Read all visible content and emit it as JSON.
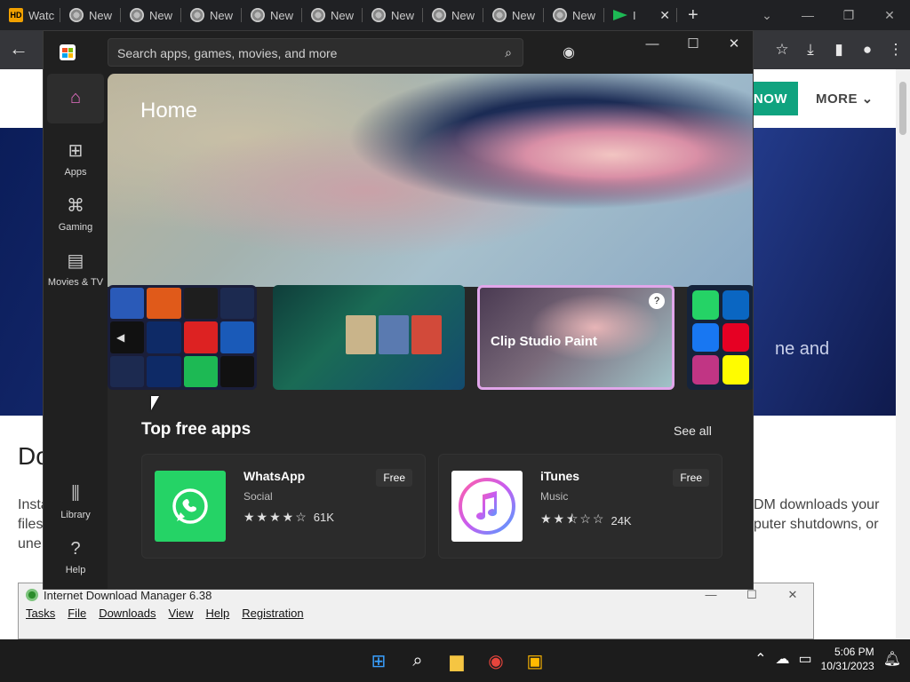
{
  "browser": {
    "tabs": [
      {
        "label": "Watc",
        "icon": "hd-icon"
      },
      {
        "label": "New",
        "icon": "chrome-icon"
      },
      {
        "label": "New",
        "icon": "chrome-icon"
      },
      {
        "label": "New",
        "icon": "chrome-icon"
      },
      {
        "label": "New",
        "icon": "chrome-icon"
      },
      {
        "label": "New",
        "icon": "chrome-icon"
      },
      {
        "label": "New",
        "icon": "chrome-icon"
      },
      {
        "label": "New",
        "icon": "chrome-icon"
      },
      {
        "label": "New",
        "icon": "chrome-icon"
      },
      {
        "label": "New",
        "icon": "chrome-icon"
      },
      {
        "label": "I",
        "icon": "flag-icon"
      }
    ]
  },
  "webpage": {
    "now_label": "NOW",
    "more_label": "MORE",
    "banner_fragment": "ne and",
    "heading_fragment": "Do",
    "para_left": [
      "Insta",
      "files",
      "une"
    ],
    "para_right": [
      "DM downloads your",
      "puter shutdowns, or"
    ]
  },
  "idm": {
    "title": "Internet Download Manager 6.38",
    "menu": [
      "Tasks",
      "File",
      "Downloads",
      "View",
      "Help",
      "Registration"
    ]
  },
  "store": {
    "search_placeholder": "Search apps, games, movies, and more",
    "nav": [
      {
        "label": "",
        "icon": "home-icon"
      },
      {
        "label": "Apps",
        "icon": "apps-icon"
      },
      {
        "label": "Gaming",
        "icon": "gamepad-icon"
      },
      {
        "label": "Movies & TV",
        "icon": "movie-icon"
      },
      {
        "label": "Library",
        "icon": "library-icon"
      },
      {
        "label": "Help",
        "icon": "help-icon"
      }
    ],
    "hero_title": "Home",
    "carousel_card_label": "Clip Studio Paint",
    "section_title": "Top free apps",
    "see_all": "See all",
    "apps": [
      {
        "name": "WhatsApp",
        "category": "Social",
        "rating": 4.0,
        "reviews": "61K",
        "price": "Free",
        "color": "#25d366"
      },
      {
        "name": "iTunes",
        "category": "Music",
        "rating": 2.5,
        "reviews": "24K",
        "price": "Free",
        "color": "#ffffff"
      }
    ]
  },
  "taskbar": {
    "time": "5:06 PM",
    "date": "10/31/2023"
  }
}
